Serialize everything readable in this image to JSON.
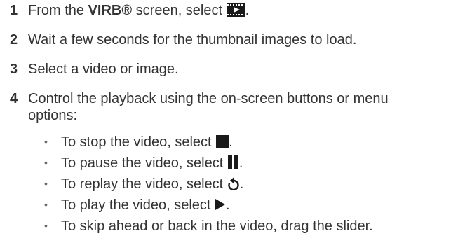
{
  "steps": [
    {
      "number": "1",
      "pre": "From the ",
      "bold": "VIRB®",
      "post": " screen, select ",
      "after_icon": ".",
      "icon": "video-gallery-icon"
    },
    {
      "number": "2",
      "text": "Wait a few seconds for the thumbnail images to load."
    },
    {
      "number": "3",
      "text": "Select a video or image."
    },
    {
      "number": "4",
      "line1": "Control the playback using the on-screen buttons or menu",
      "line2": "options:"
    }
  ],
  "bullets": [
    {
      "text": "To stop the video, select ",
      "after_icon": ".",
      "icon": "stop-icon"
    },
    {
      "text": "To pause the video, select ",
      "after_icon": ".",
      "icon": "pause-icon"
    },
    {
      "text": "To replay the video, select ",
      "after_icon": ".",
      "icon": "replay-icon"
    },
    {
      "text": "To play the video, select ",
      "after_icon": ".",
      "icon": "play-icon"
    },
    {
      "text": "To skip ahead or back in the video, drag the slider."
    }
  ],
  "bullet_glyph": "•",
  "colors": {
    "text": "#333333",
    "icon": "#1a1a1a"
  }
}
